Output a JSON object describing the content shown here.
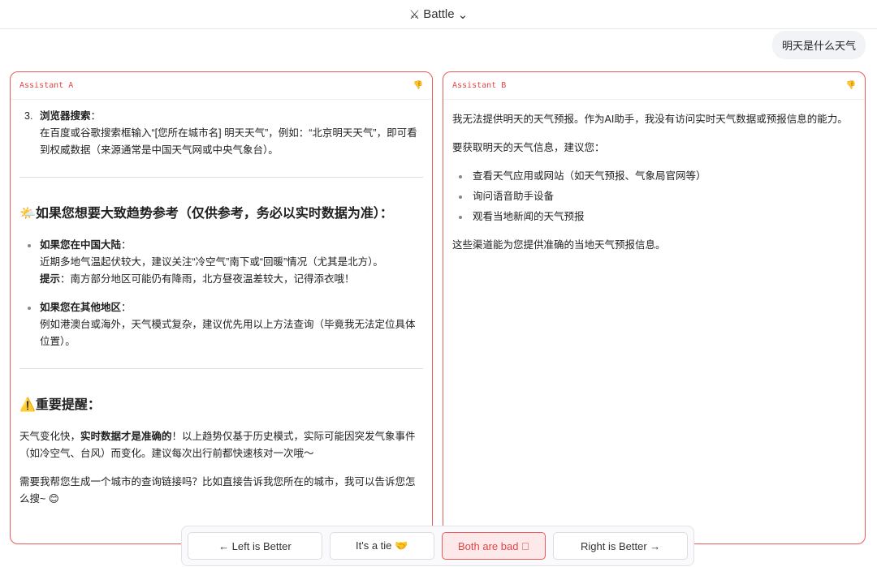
{
  "header": {
    "title": "Battle"
  },
  "user_message": "明天是什么天气",
  "panel_a": {
    "label": "Assistant A",
    "item3_title": "浏览器搜索",
    "item3_colon": "：",
    "item3_text": "在百度或谷歌搜索框输入“[您所在城市名] 明天天气”，例如：“北京明天天气”，即可看到权威数据（来源通常是中国天气网或中央气象台）。",
    "h_trend": "🌤️如果您想要大致趋势参考（仅供参考，务必以实时数据为准）：",
    "b1_title": "如果您在中国大陆",
    "b1_text": "近期多地气温起伏较大，建议关注“冷空气”南下或“回暖”情况（尤其是北方）。",
    "b1_tip_label": "提示",
    "b1_tip": "：南方部分地区可能仍有降雨，北方昼夜温差较大，记得添衣哦！",
    "b2_title": "如果您在其他地区",
    "b2_text": "例如港澳台或海外，天气模式复杂，建议优先用以上方法查询（毕竟我无法定位具体位置）。",
    "h_warn": "⚠️重要提醒：",
    "warn_pre": "天气变化快，",
    "warn_bold": "实时数据才是准确的",
    "warn_post": "！以上趋势仅基于历史模式，实际可能因突发气象事件（如冷空气、台风）而变化。建议每次出行前都快速核对一次哦～",
    "closing": "需要我帮您生成一个城市的查询链接吗？比如直接告诉我您所在的城市，我可以告诉您怎么搜~ 😊"
  },
  "panel_b": {
    "label": "Assistant B",
    "p1": "我无法提供明天的天气预报。作为AI助手，我没有访问实时天气数据或预报信息的能力。",
    "p2": "要获取明天的天气信息，建议您：",
    "items": [
      "查看天气应用或网站（如天气预报、气象局官网等）",
      "询问语音助手设备",
      "观看当地新闻的天气预报"
    ],
    "p3": "这些渠道能为您提供准确的当地天气预报信息。"
  },
  "vote": {
    "left": "← Left is Better",
    "tie": "It's a tie 🤝",
    "bad": "Both are bad ⃠",
    "right": "Right is Better →"
  }
}
